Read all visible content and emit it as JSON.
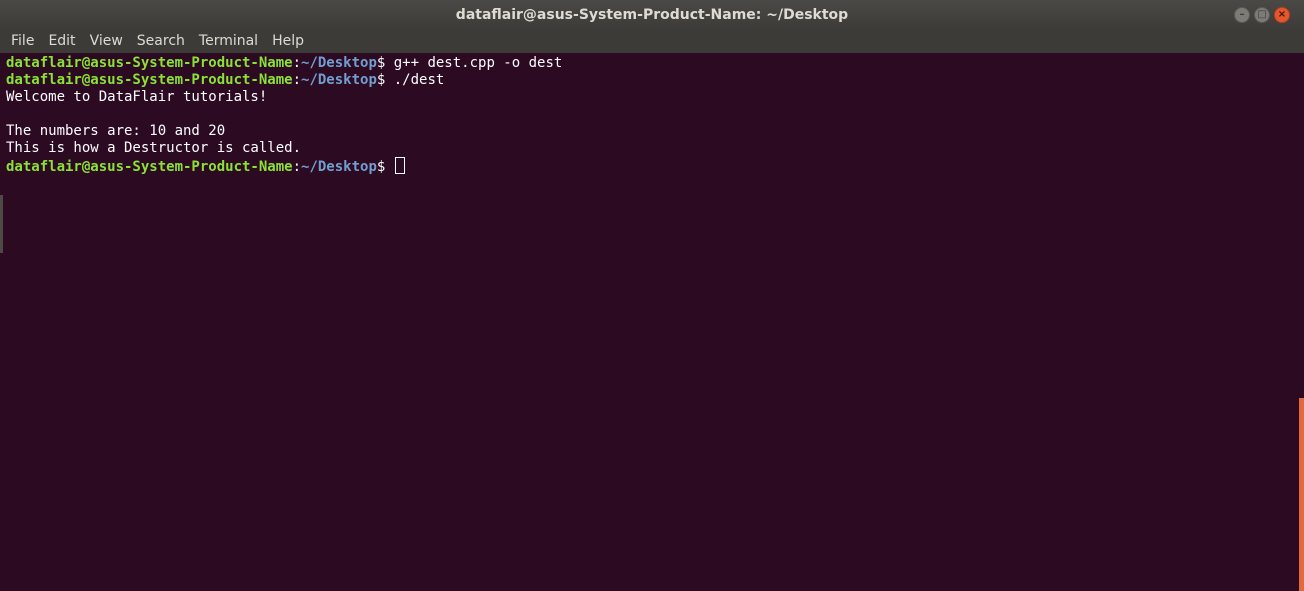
{
  "window": {
    "title": "dataflair@asus-System-Product-Name: ~/Desktop",
    "controls": {
      "minimize": "–",
      "maximize": "□",
      "close": "×"
    }
  },
  "menu": {
    "items": [
      "File",
      "Edit",
      "View",
      "Search",
      "Terminal",
      "Help"
    ]
  },
  "terminal": {
    "user_host": "dataflair@asus-System-Product-Name",
    "path": "~/Desktop",
    "prompt_symbol": "$",
    "lines": [
      {
        "type": "prompt",
        "command": "g++ dest.cpp -o dest"
      },
      {
        "type": "prompt",
        "command": "./dest"
      },
      {
        "type": "output",
        "text": "Welcome to DataFlair tutorials!"
      },
      {
        "type": "output",
        "text": ""
      },
      {
        "type": "output",
        "text": "The numbers are: 10 and 20"
      },
      {
        "type": "output",
        "text": "This is how a Destructor is called."
      },
      {
        "type": "prompt",
        "command": ""
      }
    ]
  },
  "colors": {
    "background": "#2c0a22",
    "user": "#8ae234",
    "path": "#729fcf",
    "text": "#ffffff",
    "accent": "#e0693e"
  }
}
